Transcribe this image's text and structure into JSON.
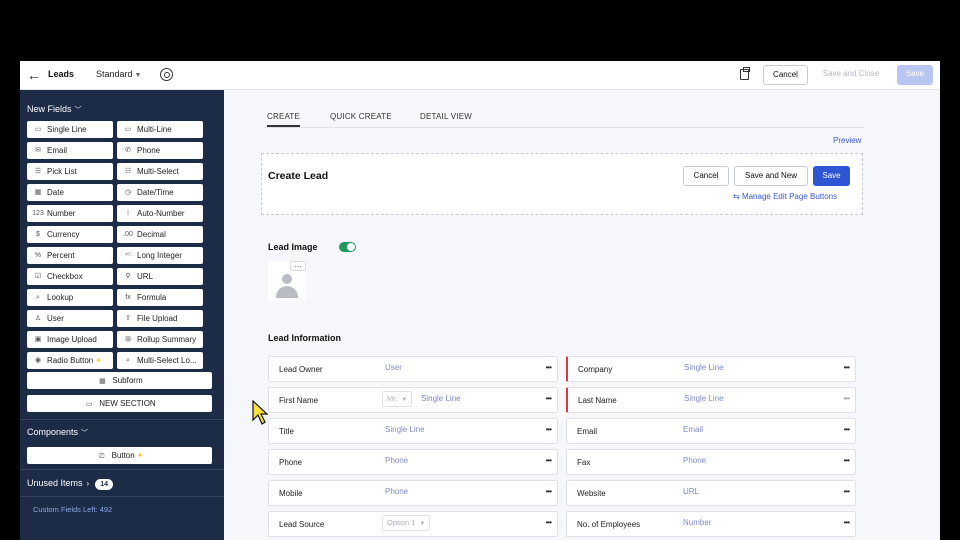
{
  "topbar": {
    "module": "Leads",
    "layout": "Standard",
    "cancel": "Cancel",
    "save_close": "Save and Close",
    "save": "Save"
  },
  "sidebar": {
    "new_fields": "New Fields",
    "fields": [
      {
        "label": "Single Line",
        "icon": "▭"
      },
      {
        "label": "Multi-Line",
        "icon": "▭"
      },
      {
        "label": "Email",
        "icon": "✉"
      },
      {
        "label": "Phone",
        "icon": "✆"
      },
      {
        "label": "Pick List",
        "icon": "☰"
      },
      {
        "label": "Multi-Select",
        "icon": "☷"
      },
      {
        "label": "Date",
        "icon": "▦"
      },
      {
        "label": "Date/Time",
        "icon": "◷"
      },
      {
        "label": "Number",
        "icon": "123"
      },
      {
        "label": "Auto-Number",
        "icon": "⋮"
      },
      {
        "label": "Currency",
        "icon": "$"
      },
      {
        "label": "Decimal",
        "icon": ".00"
      },
      {
        "label": "Percent",
        "icon": "%"
      },
      {
        "label": "Long Integer",
        "icon": "⁴⁵"
      },
      {
        "label": "Checkbox",
        "icon": "☑"
      },
      {
        "label": "URL",
        "icon": "⚲"
      },
      {
        "label": "Lookup",
        "icon": "⌕"
      },
      {
        "label": "Formula",
        "icon": "fx"
      },
      {
        "label": "User",
        "icon": "♙"
      },
      {
        "label": "File Upload",
        "icon": "⇪"
      },
      {
        "label": "Image Upload",
        "icon": "▣"
      },
      {
        "label": "Rollup Summary",
        "icon": "⊞"
      },
      {
        "label": "Radio Button",
        "icon": "◉"
      },
      {
        "label": "Multi-Select Lo...",
        "icon": "⌕"
      }
    ],
    "subform": "Subform",
    "new_section": "NEW SECTION",
    "components": "Components",
    "button": "Button",
    "unused_items": "Unused Items",
    "unused_count": "14",
    "custom_fields_left": "Custom Fields Left: 492"
  },
  "main": {
    "tabs": [
      "CREATE",
      "QUICK CREATE",
      "DETAIL VIEW"
    ],
    "preview": "Preview",
    "create_title": "Create Lead",
    "cancel": "Cancel",
    "save_new": "Save and New",
    "save": "Save",
    "manage_buttons": "Manage Edit Page Buttons",
    "lead_image": "Lead Image",
    "section_title": "Lead Information",
    "rows": [
      {
        "left": {
          "label": "Lead Owner",
          "placeholder": "User"
        },
        "right": {
          "label": "Company",
          "placeholder": "Single Line"
        }
      },
      {
        "left": {
          "label": "First Name",
          "select": "Mr.",
          "placeholder": "Single Line"
        },
        "right": {
          "label": "Last Name",
          "placeholder": "Single Line"
        }
      },
      {
        "left": {
          "label": "Title",
          "placeholder": "Single Line"
        },
        "right": {
          "label": "Email",
          "placeholder": "Email"
        }
      },
      {
        "left": {
          "label": "Phone",
          "placeholder": "Phone"
        },
        "right": {
          "label": "Fax",
          "placeholder": "Phone"
        }
      },
      {
        "left": {
          "label": "Mobile",
          "placeholder": "Phone"
        },
        "right": {
          "label": "Website",
          "placeholder": "URL"
        }
      },
      {
        "left": {
          "label": "Lead Source",
          "select": "Option 1"
        },
        "right": {
          "label": "No. of Employees",
          "placeholder": "Number"
        }
      }
    ]
  },
  "colors": {
    "sidebar_bg": "#1c2c47",
    "primary": "#2f55d4",
    "required": "#e0343b",
    "toggle_on": "#1f9a5b"
  }
}
